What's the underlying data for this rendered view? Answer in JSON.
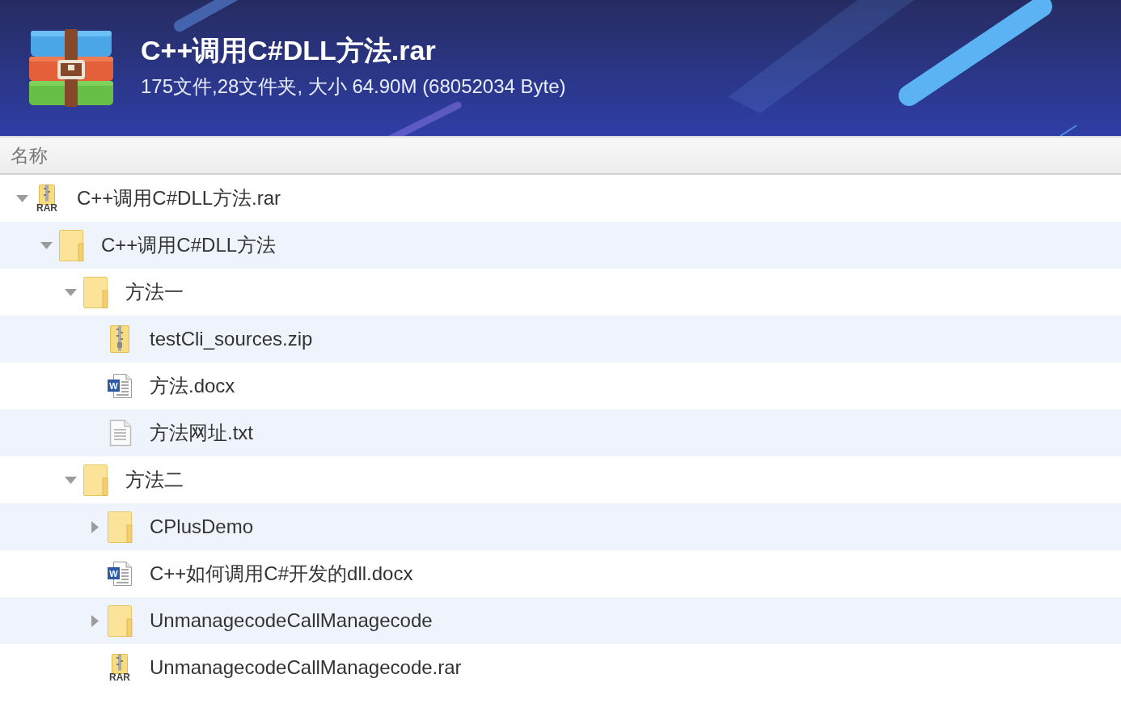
{
  "header": {
    "title": "C++调用C#DLL方法.rar",
    "summary": "175文件,28文件夹, 大小 64.90M (68052034 Byte)"
  },
  "file_list": {
    "columns": [
      "名称"
    ],
    "tree": [
      {
        "name": "C++调用C#DLL方法.rar",
        "kind": "rar",
        "icon_label": "RAR",
        "expanded": true,
        "children": [
          {
            "name": "C++调用C#DLL方法",
            "kind": "folder",
            "expanded": true,
            "children": [
              {
                "name": "方法一",
                "kind": "folder",
                "expanded": true,
                "children": [
                  {
                    "name": "testCli_sources.zip",
                    "kind": "zip"
                  },
                  {
                    "name": "方法.docx",
                    "kind": "docx",
                    "icon_label": "W"
                  },
                  {
                    "name": "方法网址.txt",
                    "kind": "txt"
                  }
                ]
              },
              {
                "name": "方法二",
                "kind": "folder",
                "expanded": true,
                "children": [
                  {
                    "name": "CPlusDemo",
                    "kind": "folder",
                    "expanded": false
                  },
                  {
                    "name": "C++如何调用C#开发的dll.docx",
                    "kind": "docx",
                    "icon_label": "W"
                  },
                  {
                    "name": "UnmanagecodeCallManagecode",
                    "kind": "folder",
                    "expanded": false
                  },
                  {
                    "name": "UnmanagecodeCallManagecode.rar",
                    "kind": "rar",
                    "icon_label": "RAR"
                  }
                ]
              }
            ]
          }
        ]
      }
    ]
  }
}
